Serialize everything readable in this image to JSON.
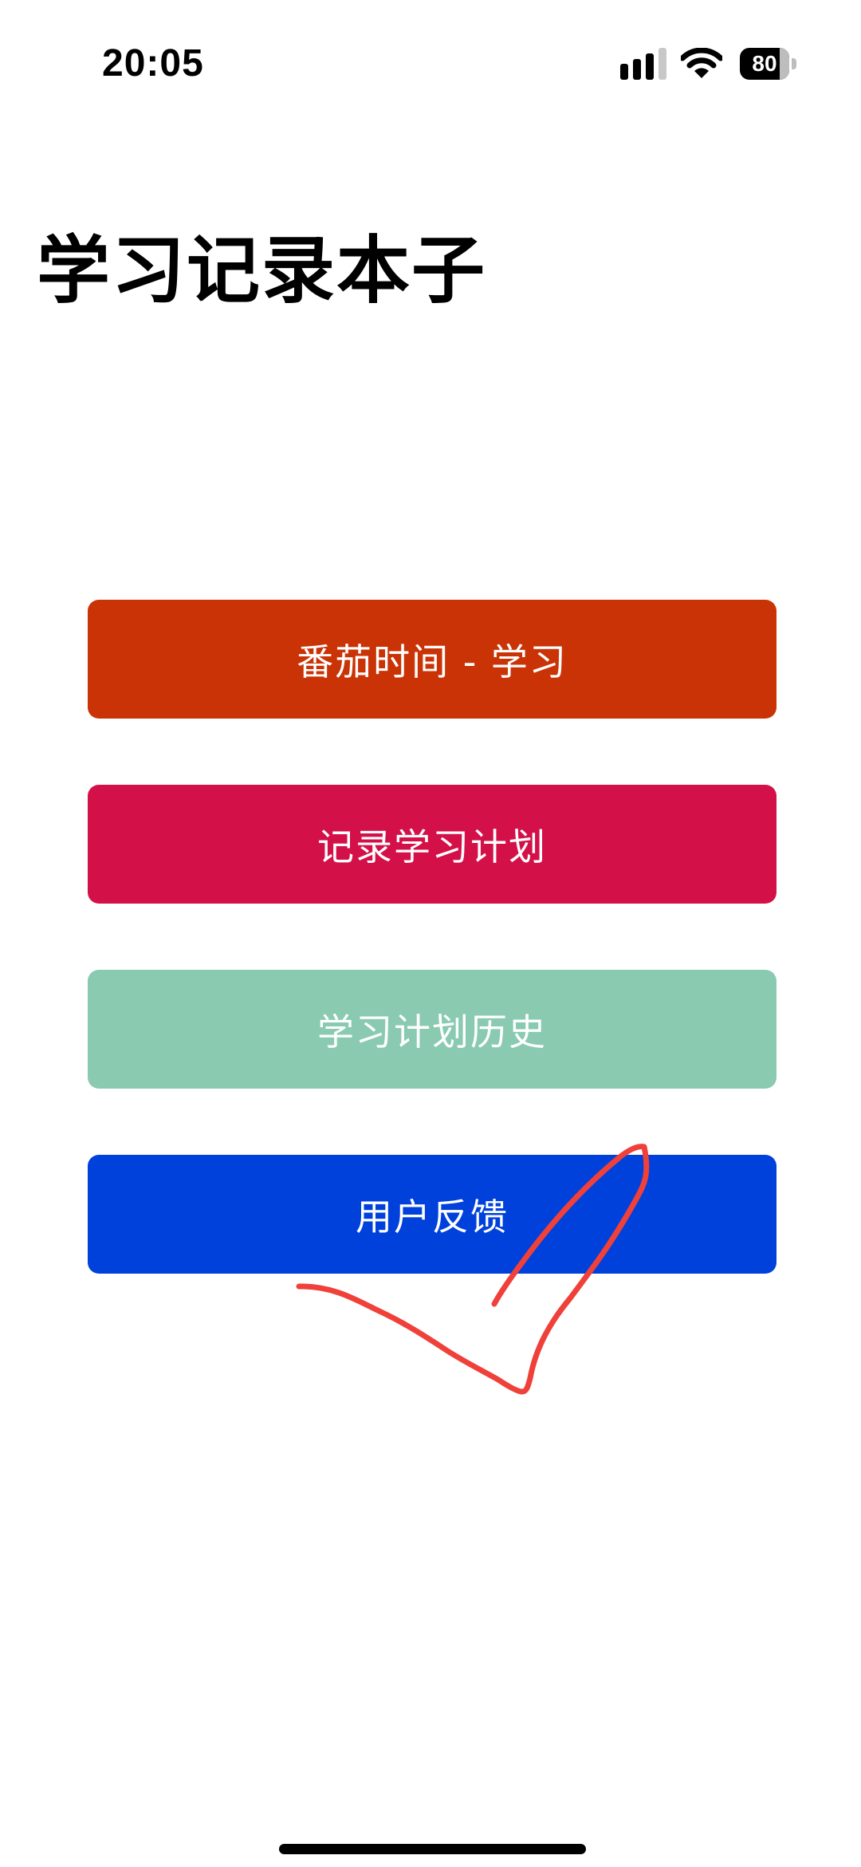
{
  "status_bar": {
    "time": "20:05",
    "battery_level": 80,
    "icons": [
      "cellular-signal-icon",
      "wifi-icon",
      "battery-icon"
    ]
  },
  "header": {
    "title": "学习记录本子"
  },
  "menu": {
    "buttons": [
      {
        "label": "番茄时间 - 学习",
        "color": "#C93305"
      },
      {
        "label": "记录学习计划",
        "color": "#D31048"
      },
      {
        "label": "学习计划历史",
        "color": "#89CAB1"
      },
      {
        "label": "用户反馈",
        "color": "#0041DC"
      }
    ]
  },
  "annotation": {
    "color": "#F0403A"
  }
}
